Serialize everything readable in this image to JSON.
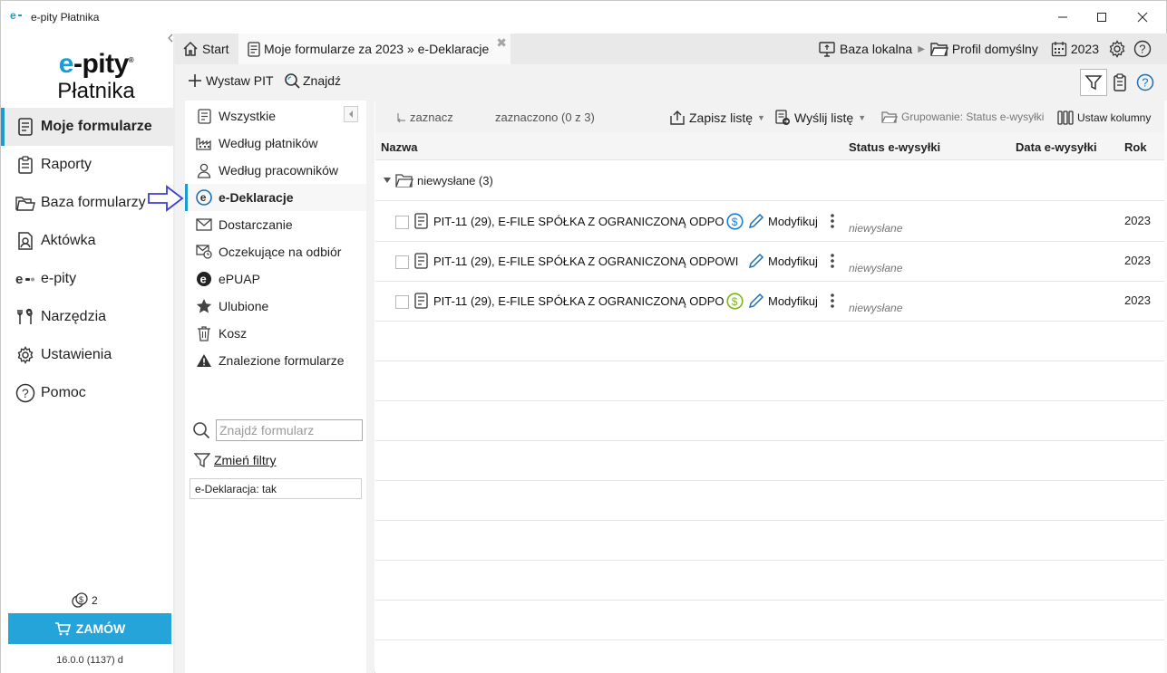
{
  "window": {
    "title": "e-pity Płatnika"
  },
  "logo": {
    "line1_e": "e",
    "line1_rest": "-pity",
    "reg": "®",
    "line2": "Płatnika"
  },
  "nav": {
    "items": [
      {
        "label": "Moje formularze",
        "icon": "document-icon",
        "active": true
      },
      {
        "label": "Raporty",
        "icon": "clipboard-icon"
      },
      {
        "label": "Baza formularzy",
        "icon": "folders-icon"
      },
      {
        "label": "Aktówka",
        "icon": "briefcase-icon"
      },
      {
        "label": "e-pity",
        "icon": "epity-icon"
      },
      {
        "label": "Narzędzia",
        "icon": "tools-icon"
      },
      {
        "label": "Ustawienia",
        "icon": "gear-icon"
      },
      {
        "label": "Pomoc",
        "icon": "help-icon"
      }
    ],
    "credits": "2",
    "order_label": "ZAMÓW",
    "version": "16.0.0 (1137) d"
  },
  "tabs": [
    {
      "label": "Start",
      "icon": "home-icon"
    },
    {
      "label": "Moje formularze za 2023 » e-Deklaracje",
      "icon": "document-icon",
      "close": "✖"
    }
  ],
  "topbar": {
    "database": "Baza lokalna",
    "profile": "Profil domyślny",
    "year": "2023"
  },
  "toolbar": {
    "issue_pit": "Wystaw PIT",
    "find": "Znajdź"
  },
  "midpanel": {
    "items": [
      {
        "label": "Wszystkie"
      },
      {
        "label": "Według płatników"
      },
      {
        "label": "Według pracowników"
      },
      {
        "label": "e-Deklaracje",
        "active": true
      },
      {
        "label": "Dostarczanie"
      },
      {
        "label": "Oczekujące na odbiór"
      },
      {
        "label": "ePUAP"
      },
      {
        "label": "Ulubione"
      },
      {
        "label": "Kosz"
      },
      {
        "label": "Znalezione formularze"
      }
    ],
    "search_placeholder": "Znajdź formularz",
    "change_filters": "Zmień filtry",
    "active_filter": "e-Deklaracja: tak"
  },
  "listbar": {
    "select": "zaznacz",
    "selected": "zaznaczono (0 z 3)",
    "save_list": "Zapisz listę",
    "send_list": "Wyślij listę",
    "grouping": "Grupowanie: Status e-wysyłki",
    "set_columns": "Ustaw kolumny"
  },
  "table": {
    "columns": [
      "Nazwa",
      "Status e-wysyłki",
      "Data e-wysyłki",
      "Rok"
    ],
    "group": "niewysłane (3)",
    "rows": [
      {
        "name": "PIT-11 (29), E-FILE SPÓŁKA Z OGRANICZONĄ ODPO",
        "coin": "blue",
        "action": "Modyfikuj",
        "status": "niewysłane",
        "year": "2023"
      },
      {
        "name": "PIT-11 (29), E-FILE SPÓŁKA Z OGRANICZONĄ ODPOWI",
        "coin": "none",
        "action": "Modyfikuj",
        "status": "niewysłane",
        "year": "2023"
      },
      {
        "name": "PIT-11 (29), E-FILE SPÓŁKA Z OGRANICZONĄ ODPO",
        "coin": "green",
        "action": "Modyfikuj",
        "status": "niewysłane",
        "year": "2023"
      }
    ]
  },
  "colors": {
    "accent": "#1c9bd2",
    "order_button": "#25a4d9",
    "coin_blue": "#1a7fd0",
    "coin_green": "#7cb518"
  }
}
